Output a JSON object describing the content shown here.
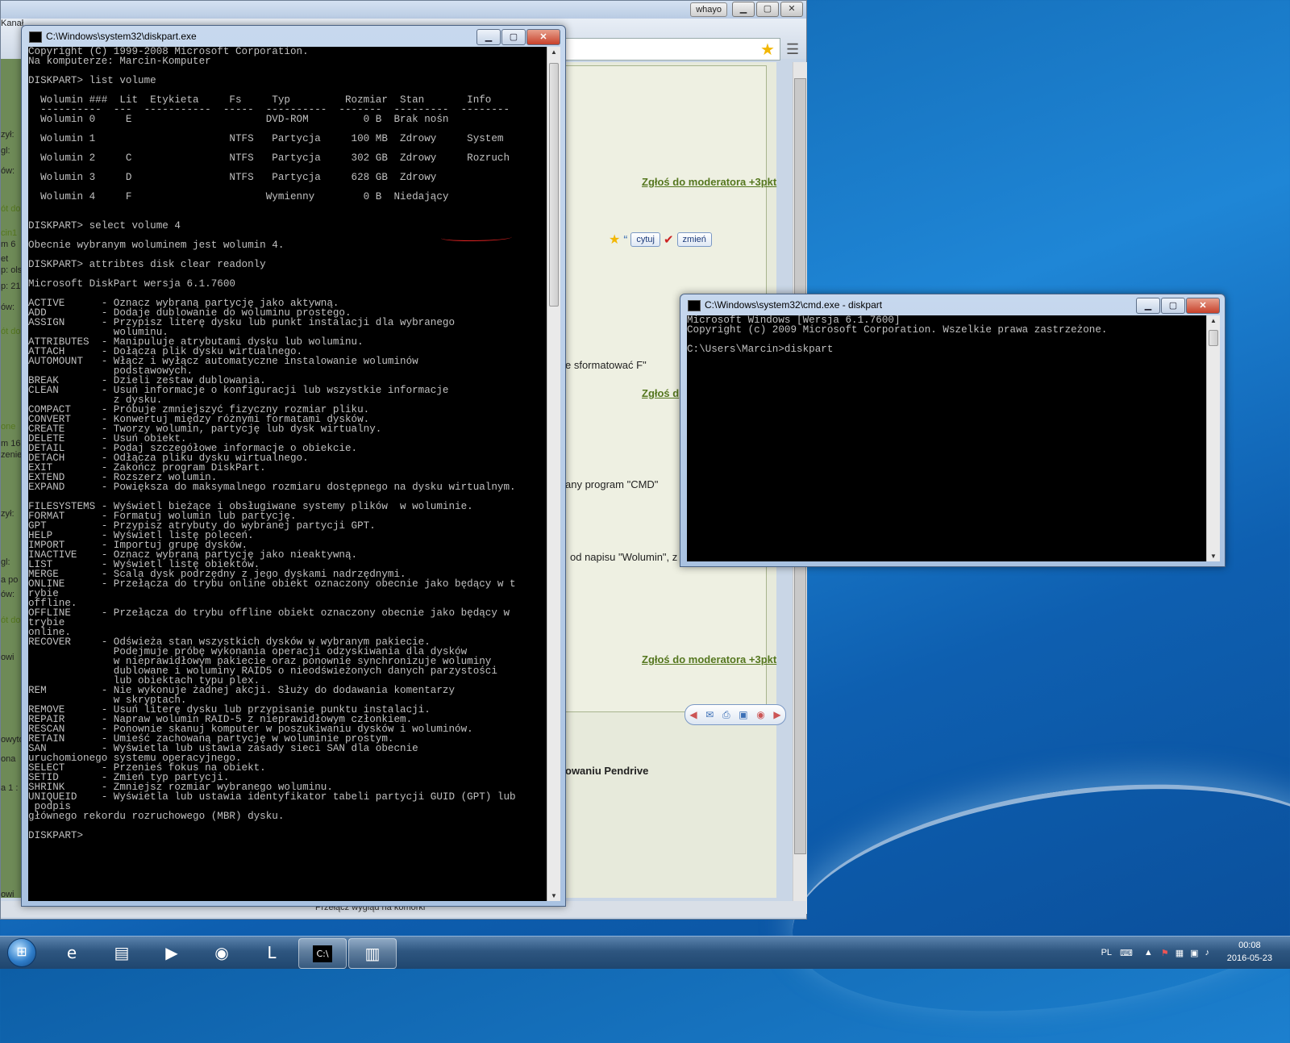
{
  "browser": {
    "user_button": "whayo",
    "ctrl_min": "▁",
    "ctrl_max": "▢",
    "ctrl_close": "✕",
    "left_fragments": [
      "Kanał",
      "zył:",
      "gl:",
      "ów:",
      "ót do",
      "cin1",
      "m 6",
      "et",
      "p: ols",
      "p: 21",
      "ów:",
      "ót do",
      "one",
      "m 16",
      "zenie",
      "zył:",
      "gl:",
      "a po",
      "ów:",
      "ót do",
      "owi",
      "owyto",
      "ona",
      "a 1 :",
      "owi"
    ],
    "report_link_1": "Zgłoś do moderatora +3pkt",
    "quote_button": "cytuj",
    "edit_button": "zmień",
    "text_format": "e sformatować F\"",
    "report_link_2": "Zgłoś d",
    "text_cmd": "any program \"CMD\"",
    "text_wolumin": "od napisu \"Wolumin\", z",
    "report_link_3": "Zgłoś do moderatora +3pkt",
    "text_pendrive": "owaniu Pendrive",
    "status_text": "Przełącz wygląd na komórki"
  },
  "diskpart_window": {
    "title": "C:\\Windows\\system32\\diskpart.exe",
    "lines": [
      "Copyright (C) 1999-2008 Microsoft Corporation.",
      "Na komputerze: Marcin-Komputer",
      "",
      "DISKPART> list volume",
      "",
      "  Wolumin ###  Lit  Etykieta     Fs     Typ         Rozmiar  Stan       Info",
      "  ----------  ---  -----------  -----  ----------  -------  ---------  --------",
      "  Wolumin 0     E                      DVD-ROM         0 B  Brak nośn",
      "",
      "  Wolumin 1                      NTFS   Partycja     100 MB  Zdrowy     System",
      "",
      "  Wolumin 2     C                NTFS   Partycja     302 GB  Zdrowy     Rozruch",
      "",
      "  Wolumin 3     D                NTFS   Partycja     628 GB  Zdrowy",
      "",
      "  Wolumin 4     F                      Wymienny        0 B  Niedający",
      "",
      "",
      "DISKPART> select volume 4",
      "",
      "Obecnie wybranym woluminem jest wolumin 4.",
      "",
      "DISKPART> attribtes disk clear readonly",
      "",
      "Microsoft DiskPart wersja 6.1.7600",
      "",
      "ACTIVE      - Oznacz wybraną partycję jako aktywną.",
      "ADD         - Dodaje dublowanie do woluminu prostego.",
      "ASSIGN      - Przypisz literę dysku lub punkt instalacji dla wybranego",
      "              woluminu.",
      "ATTRIBUTES  - Manipuluje atrybutami dysku lub woluminu.",
      "ATTACH      - Dołącza plik dysku wirtualnego.",
      "AUTOMOUNT   - Włącz i wyłącz automatyczne instalowanie woluminów",
      "              podstawowych.",
      "BREAK       - Dzieli zestaw dublowania.",
      "CLEAN       - Usuń informacje o konfiguracji lub wszystkie informacje",
      "              z dysku.",
      "COMPACT     - Próbuje zmniejszyć fizyczny rozmiar pliku.",
      "CONVERT     - Konwertuj między różnymi formatami dysków.",
      "CREATE      - Tworzy wolumin, partycję lub dysk wirtualny.",
      "DELETE      - Usuń obiekt.",
      "DETAIL      - Podaj szczegółowe informacje o obiekcie.",
      "DETACH      - Odłącza pliku dysku wirtualnego.",
      "EXIT        - Zakończ program DiskPart.",
      "EXTEND      - Rozszerz wolumin.",
      "EXPAND      - Powiększa do maksymalnego rozmiaru dostępnego na dysku wirtualnym.",
      "",
      "FILESYSTEMS - Wyświetl bieżące i obsługiwane systemy plików  w woluminie.",
      "FORMAT      - Formatuj wolumin lub partycję.",
      "GPT         - Przypisz atrybuty do wybranej partycji GPT.",
      "HELP        - Wyświetl listę poleceń.",
      "IMPORT      - Importuj grupę dysków.",
      "INACTIVE    - Oznacz wybraną partycję jako nieaktywną.",
      "LIST        - Wyświetl listę obiektów.",
      "MERGE       - Scala dysk podrzędny z jego dyskami nadrzędnymi.",
      "ONLINE      - Przełącza do trybu online obiekt oznaczony obecnie jako będący w t",
      "rybie",
      "offline.",
      "OFFLINE     - Przełącza do trybu offline obiekt oznaczony obecnie jako będący w",
      "trybie",
      "online.",
      "RECOVER     - Odświeża stan wszystkich dysków w wybranym pakiecie.",
      "              Podejmuje próbę wykonania operacji odzyskiwania dla dysków",
      "              w nieprawidłowym pakiecie oraz ponownie synchronizuje woluminy",
      "              dublowane i woluminy RAID5 o nieodświeżonych danych parzystości",
      "              lub obiektach typu plex.",
      "REM         - Nie wykonuje żadnej akcji. Służy do dodawania komentarzy",
      "              w skryptach.",
      "REMOVE      - Usuń literę dysku lub przypisanie punktu instalacji.",
      "REPAIR      - Napraw wolumin RAID-5 z nieprawidłowym członkiem.",
      "RESCAN      - Ponownie skanuj komputer w poszukiwaniu dysków i woluminów.",
      "RETAIN      - Umieść zachowaną partycję w woluminie prostym.",
      "SAN         - Wyświetla lub ustawia zasady sieci SAN dla obecnie",
      "uruchomionego systemu operacyjnego.",
      "SELECT      - Przenieś fokus na obiekt.",
      "SETID       - Zmień typ partycji.",
      "SHRINK      - Zmniejsz rozmiar wybranego woluminu.",
      "UNIQUEID    - Wyświetla lub ustawia identyfikator tabeli partycji GUID (GPT) lub",
      " podpis",
      "głównego rekordu rozruchowego (MBR) dysku.",
      "",
      "DISKPART>"
    ]
  },
  "cmd_window": {
    "title": "C:\\Windows\\system32\\cmd.exe - diskpart",
    "lines": [
      "Microsoft Windows [Wersja 6.1.7600]",
      "Copyright (c) 2009 Microsoft Corporation. Wszelkie prawa zastrzeżone.",
      "",
      "C:\\Users\\Marcin>diskpart"
    ]
  },
  "taskbar": {
    "apps": [
      {
        "name": "internet-explorer",
        "glyph": "e"
      },
      {
        "name": "explorer",
        "glyph": "▤"
      },
      {
        "name": "media-player",
        "glyph": "▶"
      },
      {
        "name": "chrome",
        "glyph": "◉"
      },
      {
        "name": "league",
        "glyph": "L"
      },
      {
        "name": "cmd",
        "glyph": "C:\\"
      },
      {
        "name": "notepad",
        "glyph": "▥"
      }
    ],
    "language": "PL",
    "time": "00:08",
    "date": "2016-05-23"
  },
  "colors": {
    "console_bg": "#000000",
    "console_fg": "#c0c0c0",
    "desktop": "#1f86d6",
    "forum_link": "#55771f",
    "annotation_underline": "#dd2222"
  }
}
